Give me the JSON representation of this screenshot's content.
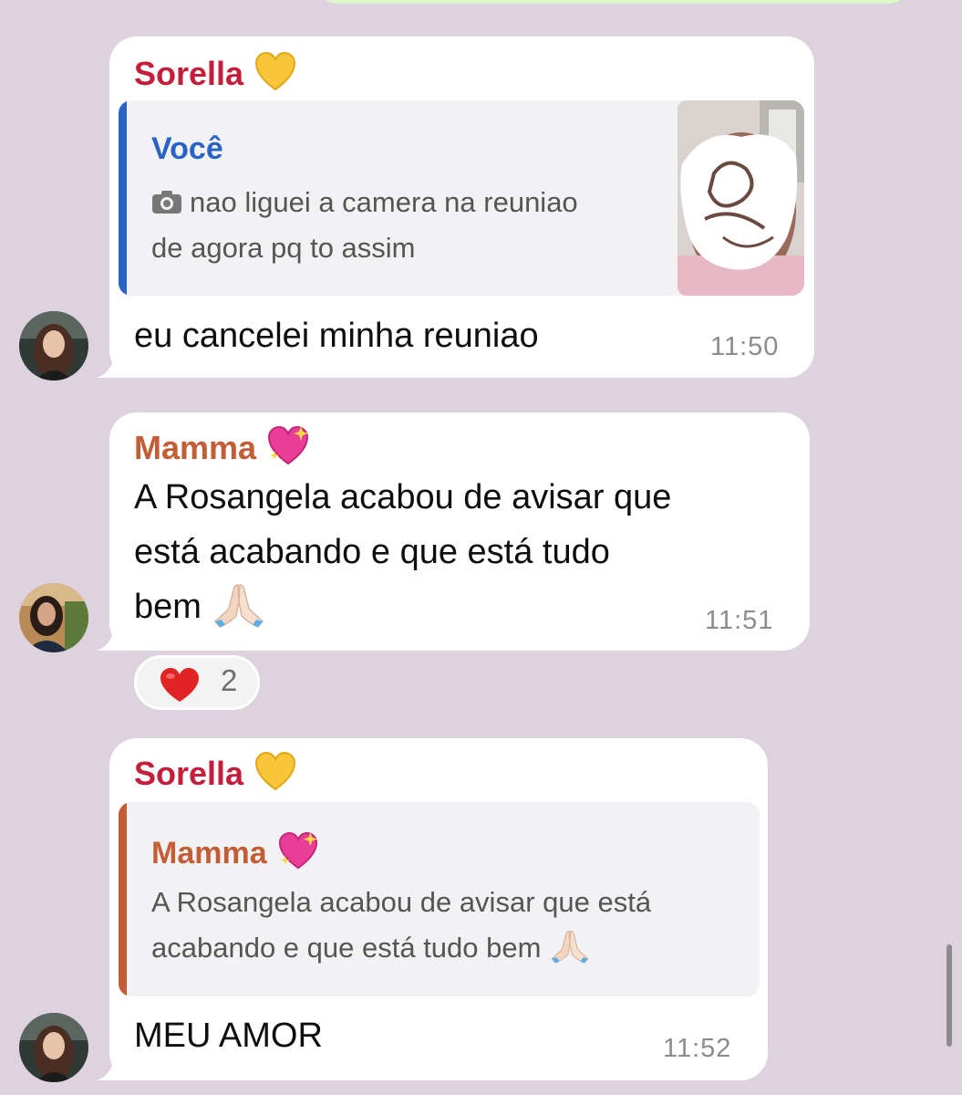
{
  "messages": [
    {
      "sender": "Sorella",
      "sender_emoji": "yellow-heart",
      "sender_color": "#c41e3a",
      "reply": {
        "name": "Você",
        "name_color": "#2a63c6",
        "bar_color": "#2a63c6",
        "lines": [
          "nao liguei a camera na reuniao",
          "de agora pq to assim"
        ],
        "has_photo": true
      },
      "text": "eu cancelei minha reuniao",
      "time": "11:50"
    },
    {
      "sender": "Mamma",
      "sender_emoji": "sparkling-heart",
      "sender_color": "#c25d35",
      "lines": [
        "A Rosangela acabou de avisar que",
        "está acabando e que está tudo",
        "bem"
      ],
      "time": "11:51",
      "reaction": {
        "emoji": "red-heart",
        "count": "2"
      }
    },
    {
      "sender": "Sorella",
      "sender_emoji": "yellow-heart",
      "sender_color": "#c41e3a",
      "reply": {
        "name": "Mamma",
        "name_color": "#c25d35",
        "bar_color": "#c25d35",
        "lines": [
          "A Rosangela acabou de avisar que está",
          "acabando e que está tudo bem"
        ],
        "has_photo": false
      },
      "text": "MEU AMOR",
      "time": "11:52"
    }
  ]
}
